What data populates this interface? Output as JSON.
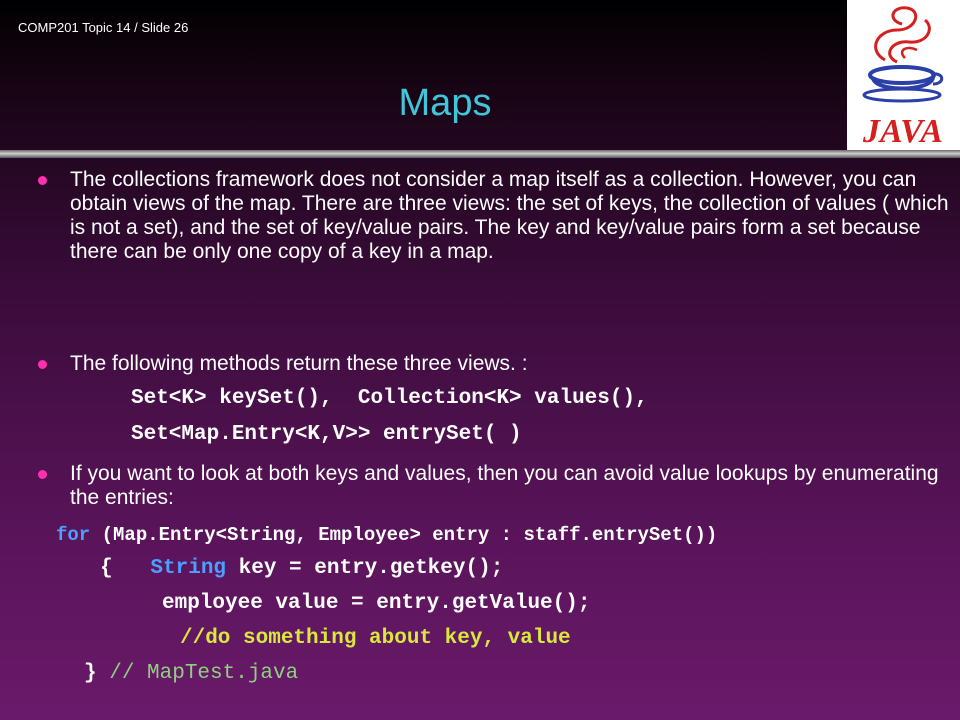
{
  "slide_id": "COMP201 Topic 14 / Slide 26",
  "logo_text": "JAVA",
  "title": "Maps",
  "bullets": [
    "The collections framework does not consider a map itself as a collection. However, you can obtain views of the map. There are three views: the set of keys, the collection of values ( which is not a set), and the set of key/value pairs. The key and key/value pairs form a set because there can be only one copy of a key in a map.",
    "The following methods return these three views. :",
    "If you want to look at both keys and values, then you can avoid value lookups by enumerating the entries:"
  ],
  "methods": {
    "line1": "Set<K> keySet(),  Collection<K> values(),",
    "line2": "Set<Map.Entry<K,V>> entrySet( )"
  },
  "code": {
    "for_kw": "for",
    "for_rest": " (Map.Entry<String, Employee> entry : staff.entrySet())",
    "brace_open": "{",
    "string_kw": "String",
    "line2_rest": " key = entry.getkey();",
    "line3": "employee value = entry.getValue();",
    "comment_line": "//do something about key, value",
    "brace_close": "}",
    "trailing_comment": " // MapTest.java"
  },
  "colors": {
    "title": "#3fc6d8",
    "bullet": "#ff2fb0",
    "keyword": "#4aa0ff",
    "comment": "#d8e83c",
    "trailing_comment": "#8fd080"
  },
  "icons": {
    "logo": "java-coffee-cup-logo",
    "bullet": "bullet-dot-icon"
  }
}
